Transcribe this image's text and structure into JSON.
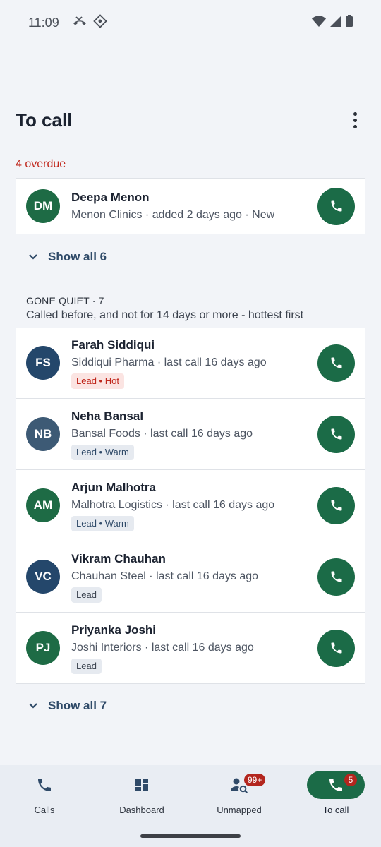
{
  "status_bar": {
    "time": "11:09"
  },
  "header": {
    "title": "To call"
  },
  "overdue": {
    "label": "4 overdue",
    "items": [
      {
        "initials": "DM",
        "name": "Deepa Menon",
        "subtitle": "Menon Clinics · added 2 days ago · New",
        "avatar_color": "#1e6b45"
      }
    ],
    "show_all_label": "Show all 6"
  },
  "gone_quiet": {
    "heading": "GONE QUIET · 7",
    "description": "Called before, and not for 14 days or more - hottest first",
    "items": [
      {
        "initials": "FS",
        "name": "Farah Siddiqui",
        "subtitle": "Siddiqui Pharma · last call 16 days ago",
        "tag": "Lead • Hot",
        "tag_style": "hot",
        "avatar_color": "#24476b"
      },
      {
        "initials": "NB",
        "name": "Neha Bansal",
        "subtitle": "Bansal Foods · last call 16 days ago",
        "tag": "Lead • Warm",
        "tag_style": "warm",
        "avatar_color": "#3d5a75"
      },
      {
        "initials": "AM",
        "name": "Arjun Malhotra",
        "subtitle": "Malhotra Logistics · last call 16 days ago",
        "tag": "Lead • Warm",
        "tag_style": "warm",
        "avatar_color": "#1e6b45"
      },
      {
        "initials": "VC",
        "name": "Vikram Chauhan",
        "subtitle": "Chauhan Steel · last call 16 days ago",
        "tag": "Lead",
        "tag_style": "plain",
        "avatar_color": "#24476b"
      },
      {
        "initials": "PJ",
        "name": "Priyanka Joshi",
        "subtitle": "Joshi Interiors · last call 16 days ago",
        "tag": "Lead",
        "tag_style": "plain",
        "avatar_color": "#1e6b45"
      }
    ],
    "show_all_label": "Show all 7"
  },
  "bottom_nav": {
    "items": [
      {
        "label": "Calls",
        "icon": "phone-icon",
        "active": false
      },
      {
        "label": "Dashboard",
        "icon": "dashboard-icon",
        "active": false
      },
      {
        "label": "Unmapped",
        "icon": "person-search-icon",
        "active": false,
        "badge": "99+"
      },
      {
        "label": "To call",
        "icon": "phone-icon",
        "active": true,
        "badge": "5"
      }
    ]
  },
  "colors": {
    "accent_green": "#1b6b47",
    "overdue_red": "#c0281d",
    "badge_red": "#b3261e"
  }
}
